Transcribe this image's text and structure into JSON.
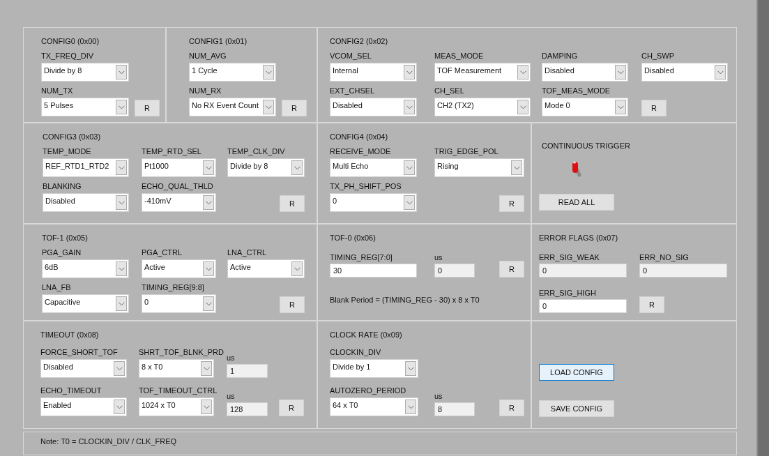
{
  "panels": [
    {
      "title": "CONFIG0 (0x00)",
      "rows": [
        [
          {
            "kind": "combo",
            "label": "TX_FREQ_DIV",
            "value": "Divide by 8"
          }
        ],
        [
          {
            "kind": "combo",
            "label": "NUM_TX",
            "value": "5 Pulses"
          },
          {
            "kind": "button",
            "label": "R",
            "focused": false
          }
        ]
      ]
    },
    {
      "title": "CONFIG1 (0x01)",
      "rows": [
        [
          {
            "kind": "combo",
            "label": "NUM_AVG",
            "value": "1 Cycle"
          }
        ],
        [
          {
            "kind": "combo",
            "label": "NUM_RX",
            "value": "No RX Event Count"
          },
          {
            "kind": "button",
            "label": "R",
            "focused": false
          }
        ]
      ]
    },
    {
      "title": "CONFIG2 (0x02)",
      "rows": [
        [
          {
            "kind": "combo",
            "label": "VCOM_SEL",
            "value": "Internal"
          },
          {
            "kind": "combo",
            "label": "MEAS_MODE",
            "value": "TOF Measurement"
          },
          {
            "kind": "combo",
            "label": "DAMPING",
            "value": "Disabled"
          },
          {
            "kind": "combo",
            "label": "CH_SWP",
            "value": "Disabled"
          }
        ],
        [
          {
            "kind": "combo",
            "label": "EXT_CHSEL",
            "value": "Disabled"
          },
          {
            "kind": "combo",
            "label": "CH_SEL",
            "value": "CH2 (TX2)"
          },
          {
            "kind": "combo",
            "label": "TOF_MEAS_MODE",
            "value": "Mode 0"
          },
          {
            "kind": "button",
            "label": "R",
            "focused": false
          }
        ]
      ]
    },
    {
      "title": "CONFIG3 (0x03)",
      "rows": [
        [
          {
            "kind": "combo",
            "label": "TEMP_MODE",
            "value": "REF_RTD1_RTD2"
          },
          {
            "kind": "combo",
            "label": "TEMP_RTD_SEL",
            "value": "Pt1000"
          },
          {
            "kind": "combo",
            "label": "TEMP_CLK_DIV",
            "value": "Divide by 8"
          }
        ],
        [
          {
            "kind": "combo",
            "label": "BLANKING",
            "value": "Disabled"
          },
          {
            "kind": "combo",
            "label": "ECHO_QUAL_THLD",
            "value": "-410mV"
          },
          {
            "kind": "button",
            "label": "R",
            "focused": false
          }
        ]
      ]
    },
    {
      "title": "CONFIG4 (0x04)",
      "rows": [
        [
          {
            "kind": "combo",
            "label": "RECEIVE_MODE",
            "value": "Multi Echo"
          },
          {
            "kind": "combo",
            "label": "TRIG_EDGE_POL",
            "value": "Rising"
          }
        ],
        [
          {
            "kind": "combo",
            "label": "TX_PH_SHIFT_POS",
            "value": "0"
          },
          {
            "kind": "button",
            "label": "R",
            "focused": false
          }
        ]
      ]
    },
    {
      "title": "CONTINUOUS TRIGGER",
      "rows": [
        [
          {
            "kind": "toggle",
            "on": false
          }
        ],
        [
          {
            "kind": "button",
            "label": "READ ALL",
            "focused": false
          }
        ]
      ]
    },
    {
      "title": "TOF-1 (0x05)",
      "rows": [
        [
          {
            "kind": "combo",
            "label": "PGA_GAIN",
            "value": "6dB"
          },
          {
            "kind": "combo",
            "label": "PGA_CTRL",
            "value": "Active"
          },
          {
            "kind": "combo",
            "label": "LNA_CTRL",
            "value": "Active"
          }
        ],
        [
          {
            "kind": "combo",
            "label": "LNA_FB",
            "value": "Capacitive"
          },
          {
            "kind": "combo",
            "label": "TIMING_REG[9:8]",
            "value": "0"
          },
          {
            "kind": "button",
            "label": "R",
            "focused": false
          }
        ]
      ]
    },
    {
      "title": "TOF-0 (0x06)",
      "rows": [
        [
          {
            "kind": "input",
            "label": "TIMING_REG[7:0]",
            "value": "30"
          },
          {
            "kind": "readout",
            "label": "us",
            "value": "0"
          },
          {
            "kind": "button",
            "label": "R",
            "focused": false
          }
        ],
        [
          {
            "kind": "text",
            "text": "Blank Period = (TIMING_REG - 30) x 8 x T0"
          }
        ]
      ]
    },
    {
      "title": "ERROR FLAGS (0x07)",
      "rows": [
        [
          {
            "kind": "readout",
            "label": "ERR_SIG_WEAK",
            "value": "0"
          },
          {
            "kind": "readout",
            "label": "ERR_NO_SIG",
            "value": "0"
          }
        ],
        [
          {
            "kind": "input",
            "label": "ERR_SIG_HIGH",
            "value": "0"
          },
          {
            "kind": "button",
            "label": "R",
            "focused": false
          }
        ]
      ]
    },
    {
      "title": "TIMEOUT (0x08)",
      "rows": [
        [
          {
            "kind": "combo",
            "label": "FORCE_SHORT_TOF",
            "value": "Disabled"
          },
          {
            "kind": "combo",
            "label": "SHRT_TOF_BLNK_PRD",
            "value": "8 x T0"
          },
          {
            "kind": "readout",
            "label": "us",
            "value": "1"
          }
        ],
        [
          {
            "kind": "combo",
            "label": "ECHO_TIMEOUT",
            "value": "Enabled"
          },
          {
            "kind": "combo",
            "label": "TOF_TIMEOUT_CTRL",
            "value": "1024 x T0"
          },
          {
            "kind": "readout",
            "label": "us",
            "value": "128"
          },
          {
            "kind": "button",
            "label": "R",
            "focused": false
          }
        ]
      ]
    },
    {
      "title": "CLOCK RATE (0x09)",
      "rows": [
        [
          {
            "kind": "combo",
            "label": "CLOCKIN_DIV",
            "value": "Divide by 1"
          }
        ],
        [
          {
            "kind": "combo",
            "label": "AUTOZERO_PERIOD",
            "value": "64 x T0"
          },
          {
            "kind": "readout",
            "label": "us",
            "value": "8"
          },
          {
            "kind": "button",
            "label": "R",
            "focused": false
          }
        ]
      ]
    },
    {
      "rows": [
        [
          {
            "kind": "button",
            "label": "LOAD CONFIG",
            "focused": true
          }
        ],
        [
          {
            "kind": "button",
            "label": "SAVE CONFIG",
            "focused": false
          }
        ]
      ]
    },
    {
      "rows": [
        [
          {
            "kind": "text",
            "text": "Note: T0 = CLOCKIN_DIV / CLK_FREQ"
          }
        ]
      ]
    }
  ]
}
